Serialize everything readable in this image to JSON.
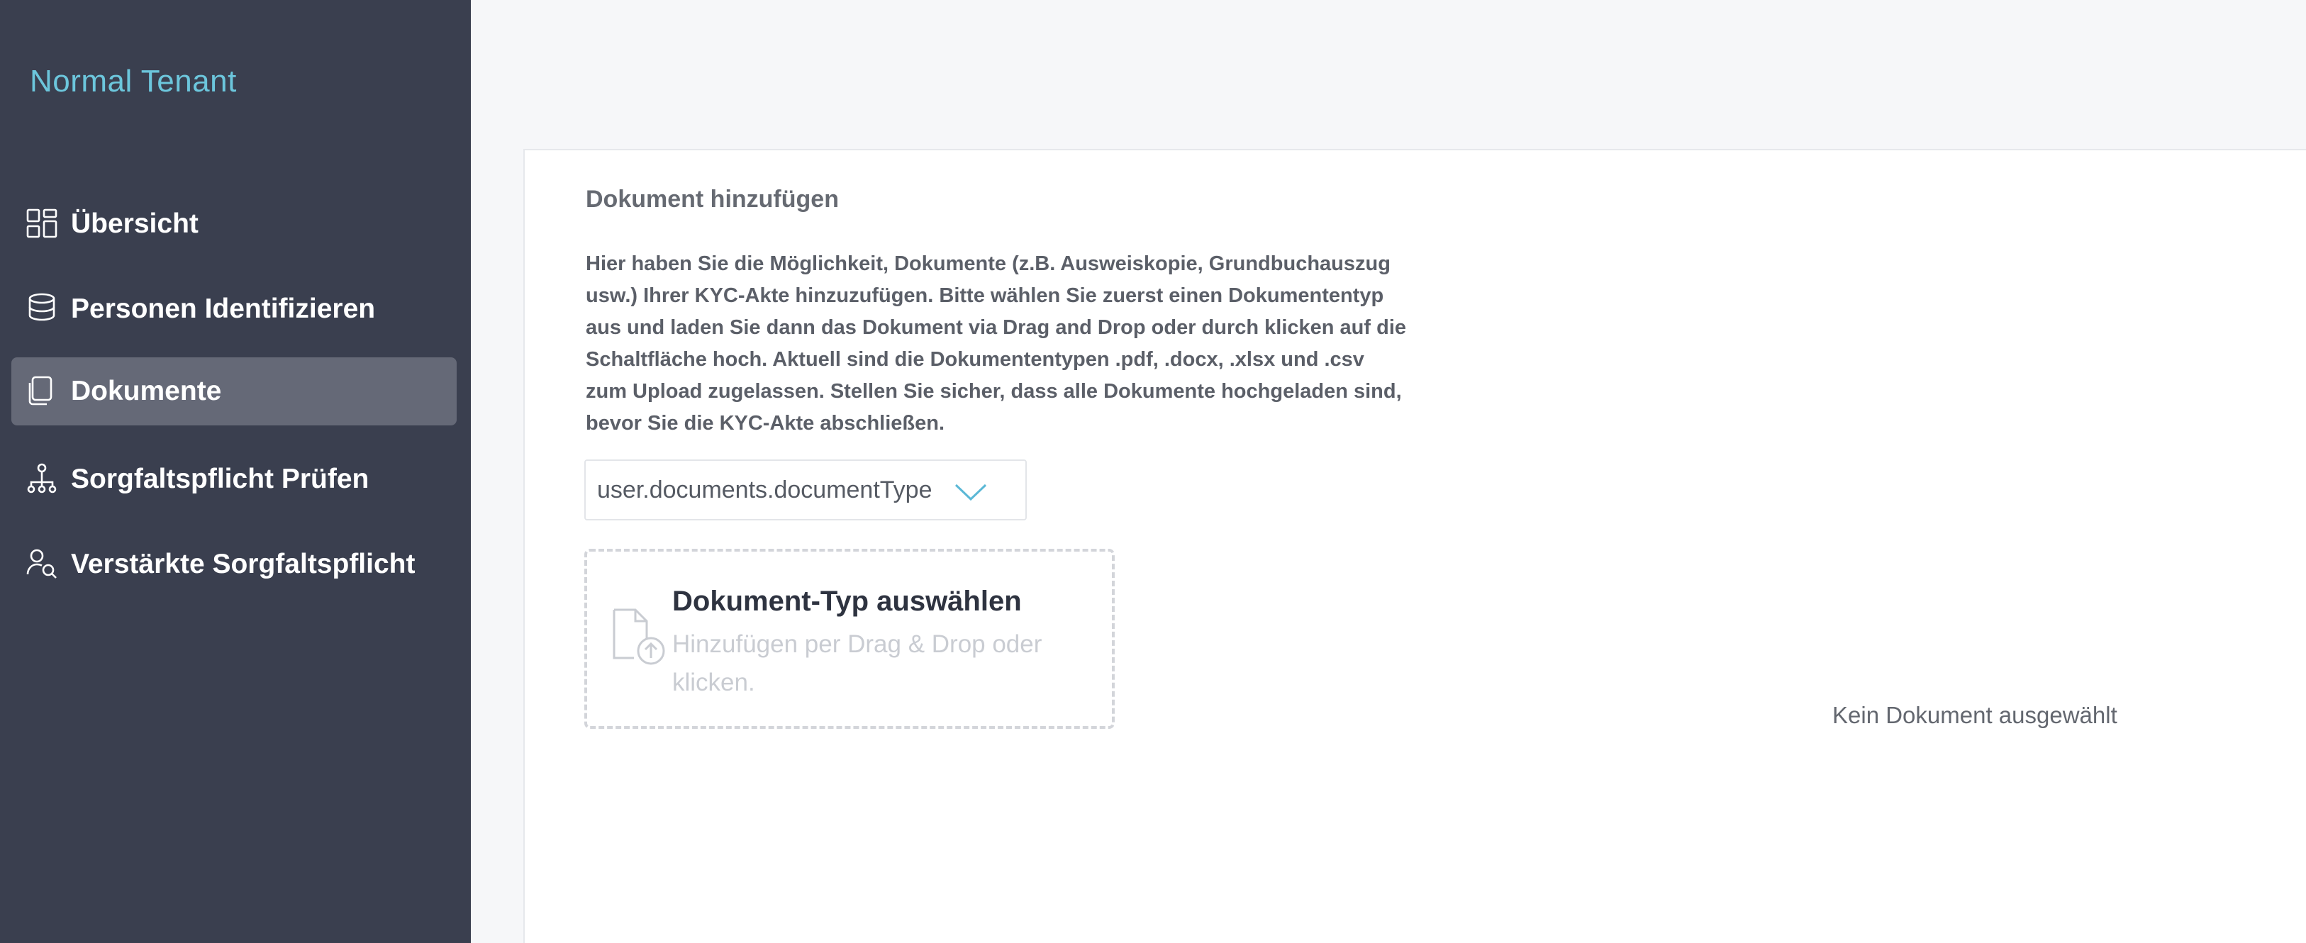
{
  "sidebar": {
    "brand": "Normal Tenant",
    "items": [
      {
        "label": "Übersicht",
        "icon": "dashboard-icon",
        "active": false
      },
      {
        "label": "Personen Identifizieren",
        "icon": "database-icon",
        "active": false
      },
      {
        "label": "Dokumente",
        "icon": "documents-icon",
        "active": true
      },
      {
        "label": "Sorgfaltspflicht Prüfen",
        "icon": "hierarchy-icon",
        "active": false
      },
      {
        "label": "Verstärkte Sorgfaltspflicht",
        "icon": "user-search-icon",
        "active": false
      }
    ]
  },
  "main": {
    "title": "Dokument hinzufügen",
    "description": "Hier haben Sie die Möglichkeit, Dokumente (z.B. Ausweiskopie, Grundbuchauszug usw.) Ihrer KYC-Akte hinzuzufügen. Bitte wählen Sie zuerst einen Dokumententyp aus und laden Sie dann das Dokument via Drag and Drop oder durch klicken auf die Schaltfläche hoch. Aktuell sind die Dokumententypen .pdf, .docx, .xlsx und .csv zum Upload zugelassen. Stellen Sie sicher, dass alle Dokumente hochgeladen sind, bevor Sie die KYC-Akte abschließen.",
    "document_type_select": {
      "value": "user.documents.documentType",
      "icon": "chevron-down-icon"
    },
    "dropzone": {
      "title": "Dokument-Typ auswählen",
      "hint": "Hinzufügen per Drag & Drop oder klicken.",
      "icon": "file-upload-icon"
    },
    "empty_state": "Kein Dokument ausgewählt"
  },
  "colors": {
    "sidebar_bg": "#3a3f4f",
    "sidebar_active": "#656977",
    "brand": "#6cc6dc",
    "accent": "#5bb8d6"
  }
}
